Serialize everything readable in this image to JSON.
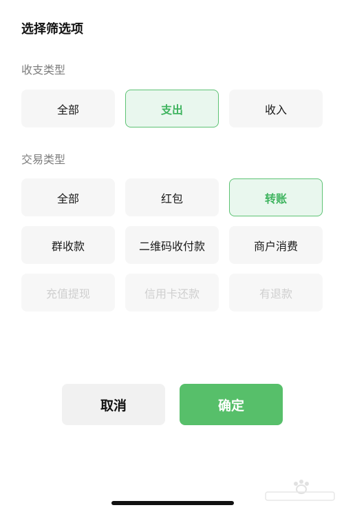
{
  "title": "选择筛选项",
  "income_expense": {
    "label": "收支类型",
    "options": [
      "全部",
      "支出",
      "收入"
    ],
    "selected": "支出"
  },
  "transaction": {
    "label": "交易类型",
    "options": [
      "全部",
      "红包",
      "转账",
      "群收款",
      "二维码收付款",
      "商户消费",
      "充值提现",
      "信用卡还款",
      "有退款"
    ],
    "selected": "转账",
    "disabled": [
      "充值提现",
      "信用卡还款",
      "有退款"
    ]
  },
  "buttons": {
    "cancel": "取消",
    "confirm": "确定"
  },
  "colors": {
    "accent": "#57bf6a",
    "selected_bg": "#e9f7ee",
    "chip_bg": "#f6f6f6"
  }
}
